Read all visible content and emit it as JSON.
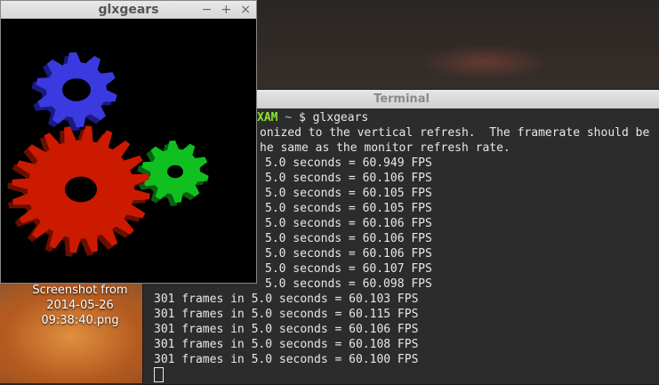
{
  "desktop": {
    "icon_label_lines": [
      "Screenshot from",
      "2014-05-26",
      "09:38:40.png"
    ]
  },
  "terminal": {
    "title": "Terminal",
    "prompt_user": "XAM",
    "prompt_path": "~",
    "prompt_symbol": "$",
    "command": "glxgears",
    "lines": [
      "onized to the vertical refresh.  The framerate should be",
      "he same as the monitor refresh rate.",
      "5.0 seconds = 60.949 FPS",
      "5.0 seconds = 60.106 FPS",
      "5.0 seconds = 60.105 FPS",
      "5.0 seconds = 60.105 FPS",
      "5.0 seconds = 60.106 FPS",
      "5.0 seconds = 60.106 FPS",
      "5.0 seconds = 60.106 FPS",
      "5.0 seconds = 60.107 FPS",
      "5.0 seconds = 60.098 FPS",
      "301 frames in 5.0 seconds = 60.103 FPS",
      "301 frames in 5.0 seconds = 60.115 FPS",
      "301 frames in 5.0 seconds = 60.106 FPS",
      "301 frames in 5.0 seconds = 60.108 FPS",
      "301 frames in 5.0 seconds = 60.100 FPS"
    ]
  },
  "glxgears": {
    "title": "glxgears",
    "minimize": "−",
    "maximize": "+",
    "close": "×",
    "colors": {
      "blue": "#3a3ae0",
      "red": "#cc1a00",
      "green": "#10c020"
    }
  }
}
